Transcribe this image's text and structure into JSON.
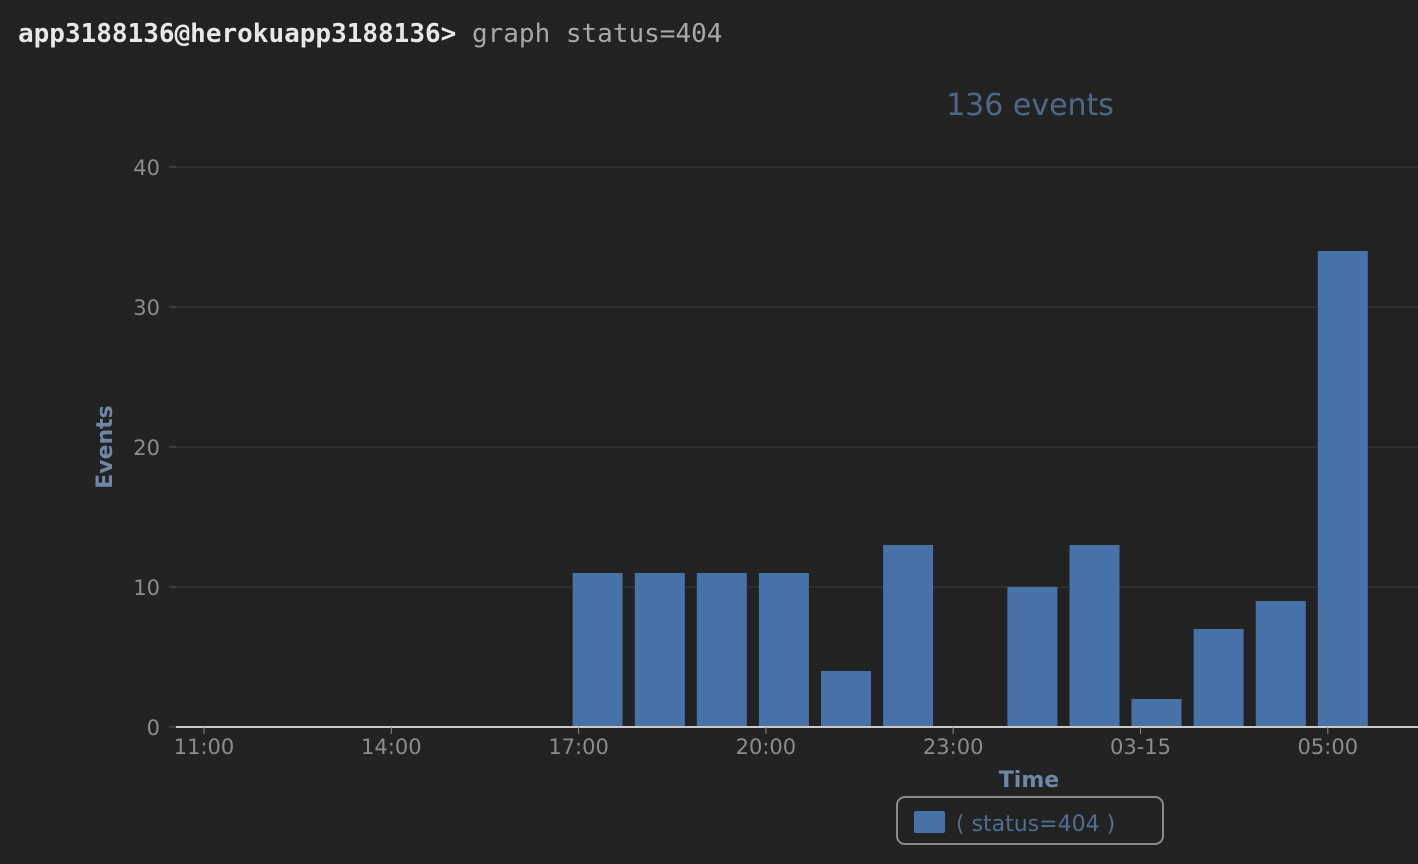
{
  "terminal": {
    "prompt": "app3188136@herokuapp3188136>",
    "command": "graph status=404"
  },
  "chart_data": {
    "type": "bar",
    "title": "136 events",
    "xlabel": "Time",
    "ylabel": "Events",
    "ylim": [
      0,
      40
    ],
    "yticks": [
      0,
      10,
      20,
      30,
      40
    ],
    "xticks": [
      "11:00",
      "14:00",
      "17:00",
      "20:00",
      "23:00",
      "03-15",
      "05:00"
    ],
    "grid": true,
    "legend_position": "bottom-center",
    "bar_color": "#4672a8",
    "series": [
      {
        "name": "( status=404 )",
        "values": [
          0,
          0,
          0,
          0,
          0,
          0,
          11,
          11,
          11,
          11,
          4,
          13,
          0,
          10,
          13,
          2,
          7,
          9,
          34
        ]
      }
    ]
  }
}
